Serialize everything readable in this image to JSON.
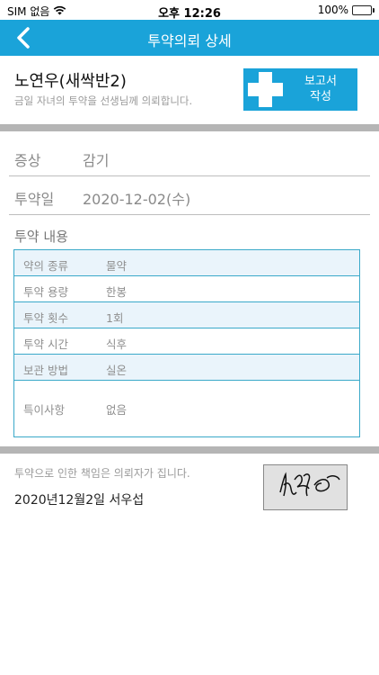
{
  "status_bar": {
    "carrier": "SIM 없음",
    "time": "오후 12:26",
    "battery": "100%"
  },
  "nav": {
    "title": "투약의뢰 상세",
    "back_icon": "chevron-left-icon"
  },
  "header": {
    "child_name": "노연우(새싹반2)",
    "subtitle": "금일 자녀의 투약을 선생님께 의뢰합니다.",
    "report_button": "보고서\n작성",
    "report_icon": "medical-cross-icon"
  },
  "fields": [
    {
      "label": "증상",
      "value": "감기"
    },
    {
      "label": "투약일",
      "value": "2020-12-02(수)"
    }
  ],
  "details": {
    "title": "투약 내용",
    "rows": [
      {
        "label": "약의 종류",
        "value": "물약"
      },
      {
        "label": "투약 용량",
        "value": "한봉"
      },
      {
        "label": "투약 횟수",
        "value": "1회"
      },
      {
        "label": "투약 시간",
        "value": "식후"
      },
      {
        "label": "보관 방법",
        "value": "실온"
      }
    ],
    "note": {
      "label": "특이사항",
      "value": "없음"
    }
  },
  "footer": {
    "responsibility": "투약으로 인한 책임은 의뢰자가 집니다.",
    "signed": "2020년12월2일 서우섭"
  },
  "colors": {
    "accent": "#1aa3d9",
    "table_border": "#3aa9c9",
    "row_alt": "#eaf4fb",
    "separator": "#b5b5b5"
  }
}
